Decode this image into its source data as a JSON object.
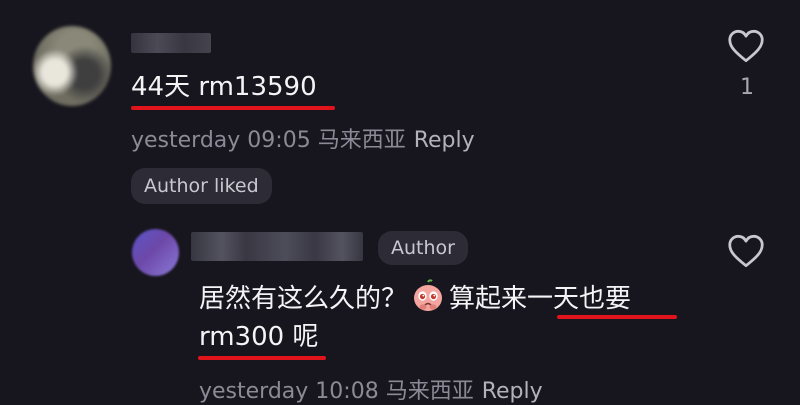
{
  "comment": {
    "text_number": "44",
    "text_rest": "天 rm13590",
    "time": "yesterday 09:05",
    "location": "马来西亚",
    "reply_label": "Reply",
    "author_liked_label": "Author liked",
    "like_count": "1"
  },
  "reply": {
    "author_badge": "Author",
    "line1_before_emoji": "居然有这么久的？",
    "line1_after_emoji": "算起来一天也要",
    "line2": "rm300 呢",
    "time": "yesterday 10:08",
    "location": "马来西亚",
    "reply_label": "Reply"
  },
  "colors": {
    "background": "#17161e",
    "underline": "#e0141a",
    "pill": "#2d2c36"
  },
  "icons": [
    "heart-icon",
    "pleading-face-emoji"
  ]
}
